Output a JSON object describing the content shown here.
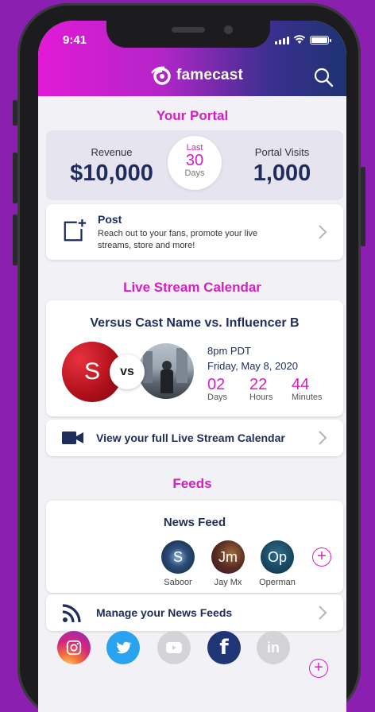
{
  "status_bar": {
    "time": "9:41"
  },
  "header": {
    "brand": "famecast"
  },
  "portal": {
    "title": "Your Portal",
    "revenue_label": "Revenue",
    "revenue_value": "$10,000",
    "period_top": "Last",
    "period_num": "30",
    "period_unit": "Days",
    "visits_label": "Portal Visits",
    "visits_value": "1,000",
    "post_title": "Post",
    "post_desc_1": "Reach out to your fans, promote your live",
    "post_desc_2": "streams, store and more!"
  },
  "calendar": {
    "title": "Live Stream Calendar",
    "cast_name": "Versus Cast Name vs. Influencer B",
    "avatar_letter": "S",
    "vs_label": "vs",
    "time": "8pm PDT",
    "date": "Friday, May 8, 2020",
    "countdown": [
      {
        "num": "02",
        "unit": "Days"
      },
      {
        "num": "22",
        "unit": "Hours"
      },
      {
        "num": "44",
        "unit": "Minutes"
      }
    ],
    "link_label": "View your full Live Stream Calendar"
  },
  "feeds": {
    "title": "Feeds",
    "news_feed_title": "News Feed",
    "people": [
      {
        "initials": "S",
        "name": "Saboor"
      },
      {
        "initials": "Jm",
        "name": "Jay Mx"
      },
      {
        "initials": "Op",
        "name": "Operman"
      }
    ],
    "manage_label": "Manage your News Feeds"
  },
  "social": {
    "icons": [
      "instagram-icon",
      "twitter-icon",
      "youtube-icon",
      "facebook-icon",
      "linkedin-icon"
    ],
    "facebook_letter": "f",
    "linkedin_letters": "in"
  },
  "colors": {
    "accent": "#d51ec4",
    "navy": "#1f2d5c",
    "background": "#8a1fb0"
  }
}
